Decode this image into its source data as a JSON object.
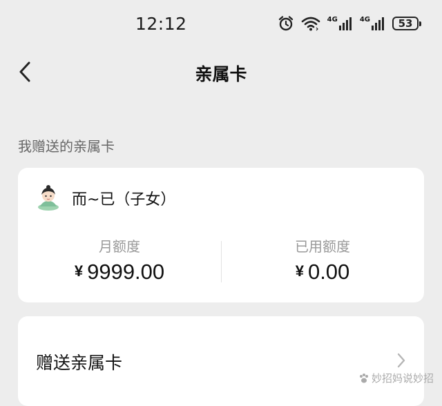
{
  "status_bar": {
    "time": "12:12",
    "battery": "53",
    "network_1": "4G",
    "network_2": "4G",
    "icons": [
      "alarm-icon",
      "wifi-icon",
      "signal-4g-icon",
      "signal-4g-icon",
      "battery-icon"
    ]
  },
  "nav": {
    "title": "亲属卡",
    "back_icon": "chevron-left-icon"
  },
  "section": {
    "title": "我赠送的亲属卡"
  },
  "member_card": {
    "name": "而~已（子女）",
    "monthly_quota_label": "月额度",
    "monthly_quota_currency": "¥",
    "monthly_quota_value": "9999.00",
    "used_quota_label": "已用额度",
    "used_quota_currency": "¥",
    "used_quota_value": "0.00"
  },
  "gift_card": {
    "label": "赠送亲属卡",
    "chevron_icon": "chevron-right-icon"
  },
  "watermark": {
    "text": "妙招妈说妙招"
  },
  "colors": {
    "background": "#ededed",
    "card": "#ffffff",
    "muted_text": "#999999",
    "section_text": "#666666"
  }
}
